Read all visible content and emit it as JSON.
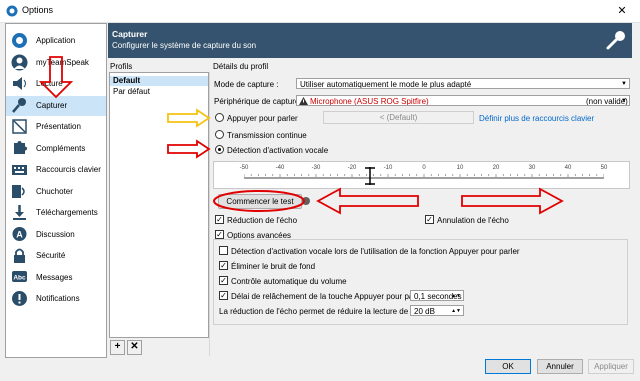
{
  "window": {
    "title": "Options",
    "close_glyph": "✕"
  },
  "sidebar": {
    "items": [
      {
        "label": "Application",
        "icon": "teamspeak-logo-icon"
      },
      {
        "label": "myTeamSpeak",
        "icon": "user-icon"
      },
      {
        "label": "Lecture",
        "icon": "speaker-icon"
      },
      {
        "label": "Capturer",
        "icon": "microphone-icon",
        "selected": true
      },
      {
        "label": "Présentation",
        "icon": "presentation-icon"
      },
      {
        "label": "Compléments",
        "icon": "puzzle-icon"
      },
      {
        "label": "Raccourcis clavier",
        "icon": "keyboard-icon"
      },
      {
        "label": "Chuchoter",
        "icon": "whisper-icon"
      },
      {
        "label": "Téléchargements",
        "icon": "download-icon"
      },
      {
        "label": "Discussion",
        "icon": "chat-icon"
      },
      {
        "label": "Sécurité",
        "icon": "lock-icon"
      },
      {
        "label": "Messages",
        "icon": "abc-messages-icon"
      },
      {
        "label": "Notifications",
        "icon": "notifications-icon"
      }
    ]
  },
  "header": {
    "title": "Capturer",
    "subtitle": "Configurer le système de capture du son"
  },
  "profiles": {
    "label": "Profils",
    "items": [
      {
        "label": "Default",
        "selected": true
      },
      {
        "label": "Par défaut"
      }
    ],
    "add_glyph": "+",
    "remove_glyph": "✕"
  },
  "details": {
    "label": "Détails du profil",
    "capture_mode": {
      "label": "Mode de capture :",
      "value": "Utiliser automatiquement le mode le plus adapté"
    },
    "capture_device": {
      "label": "Périphérique de capture :",
      "value": "Microphone (ASUS ROG Spitfire)",
      "status": "(non valide)"
    },
    "push_to_talk": {
      "label": "Appuyer pour parler",
      "hotkey": "< (Default)",
      "more_link": "Définir plus de raccourcis clavier"
    },
    "continuous": {
      "label": "Transmission continue"
    },
    "voice_activation": {
      "label": "Détection d'activation vocale",
      "selected": true
    },
    "scale_ticks": [
      "-50",
      "-40",
      "-30",
      "-20",
      "-10",
      "0",
      "10",
      "20",
      "30",
      "40",
      "50"
    ],
    "threshold_value": -15,
    "test_button": "Commencer le test",
    "echo_reduction": "Réduction de l'écho",
    "echo_cancel": "Annulation de l'écho",
    "advanced": "Options avancées",
    "adv_vad_ptt": "Détection d'activation vocale lors de l'utilisation de la fonction Appuyer pour parler",
    "adv_noise": "Éliminer le bruit de fond",
    "adv_agc": "Contrôle automatique du volume",
    "adv_release": {
      "label": "Délai de relâchement de la touche Appuyer pour parler :",
      "value": "0,1 secondes"
    },
    "adv_echo_reduce": {
      "label": "La réduction de l'écho permet de réduire la lecture de :",
      "value": "20 dB"
    }
  },
  "footer": {
    "ok": "OK",
    "cancel": "Annuler",
    "apply": "Appliquer"
  },
  "colors": {
    "header_bg": "#35536e",
    "selection": "#cce4f7",
    "annotation_red": "#e00000",
    "annotation_yellow": "#f5c211",
    "device_red": "#cc0000"
  }
}
